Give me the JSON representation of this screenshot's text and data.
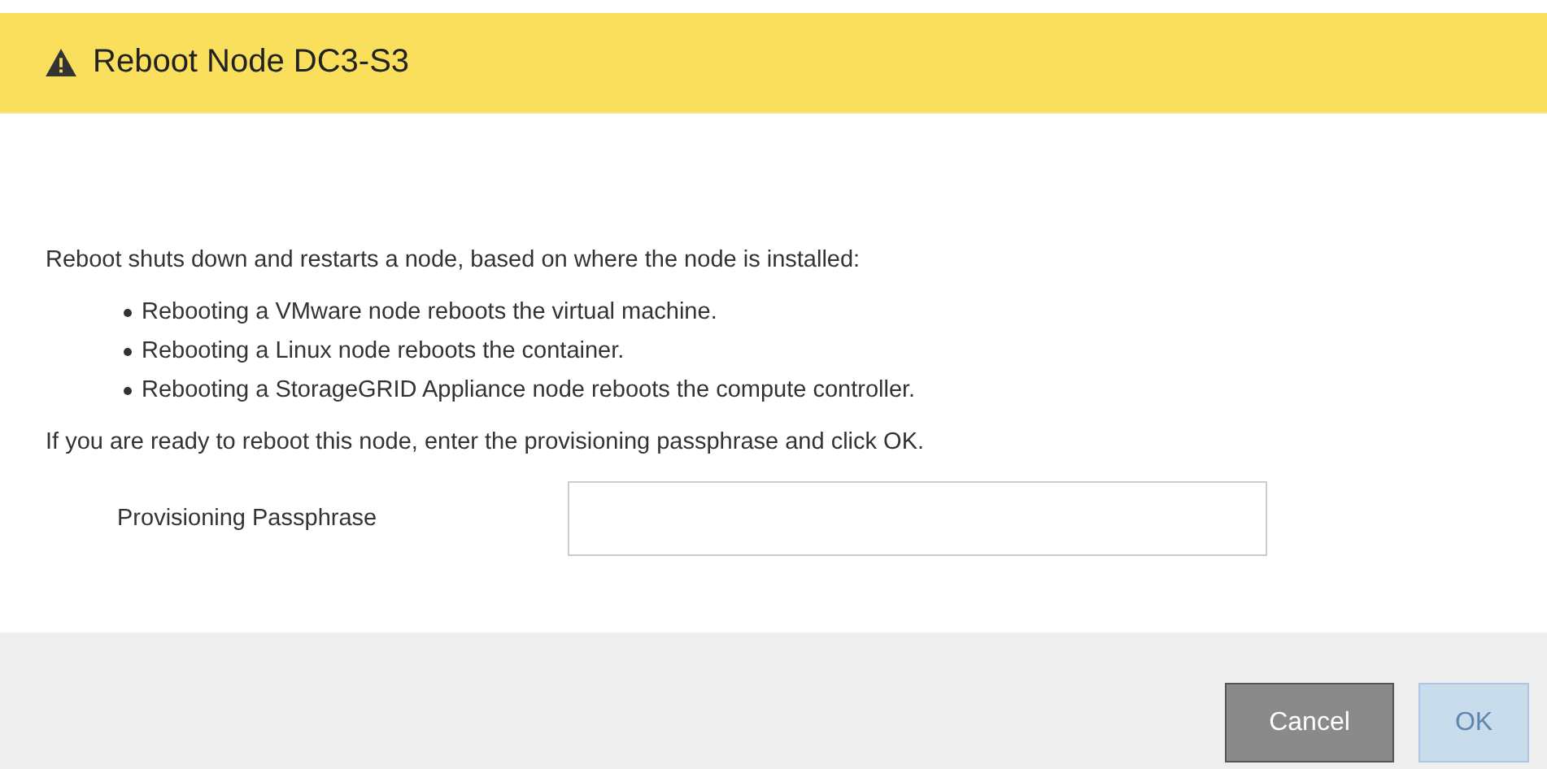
{
  "dialog": {
    "title": "Reboot Node DC3-S3",
    "intro": "Reboot shuts down and restarts a node, based on where the node is installed:",
    "bullets": [
      "Rebooting a VMware node reboots the virtual machine.",
      "Rebooting a Linux node reboots the container.",
      "Rebooting a StorageGRID Appliance node reboots the compute controller."
    ],
    "instruction": "If you are ready to reboot this node, enter the provisioning passphrase and click OK.",
    "field": {
      "label": "Provisioning Passphrase"
    },
    "buttons": [
      {
        "label": "Cancel",
        "kind": "secondary",
        "disabled": false
      },
      {
        "label": "OK",
        "kind": "primary",
        "disabled": true
      }
    ]
  }
}
